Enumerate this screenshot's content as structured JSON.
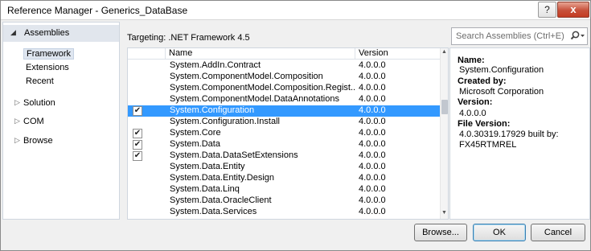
{
  "window": {
    "title": "Reference Manager - Generics_DataBase",
    "help": "?",
    "close": "x"
  },
  "nav": {
    "header": "Assemblies",
    "subitems": [
      "Framework",
      "Extensions",
      "Recent"
    ],
    "categories": [
      "Solution",
      "COM",
      "Browse"
    ]
  },
  "targeting": "Targeting: .NET Framework 4.5",
  "search": {
    "placeholder": "Search Assemblies (Ctrl+E)"
  },
  "grid": {
    "columns": {
      "name": "Name",
      "version": "Version"
    },
    "rows": [
      {
        "name": "System.AddIn.Contract",
        "version": "4.0.0.0",
        "checked": false,
        "selected": false
      },
      {
        "name": "System.ComponentModel.Composition",
        "version": "4.0.0.0",
        "checked": false,
        "selected": false
      },
      {
        "name": "System.ComponentModel.Composition.Regist...",
        "version": "4.0.0.0",
        "checked": false,
        "selected": false
      },
      {
        "name": "System.ComponentModel.DataAnnotations",
        "version": "4.0.0.0",
        "checked": false,
        "selected": false
      },
      {
        "name": "System.Configuration",
        "version": "4.0.0.0",
        "checked": true,
        "selected": true
      },
      {
        "name": "System.Configuration.Install",
        "version": "4.0.0.0",
        "checked": false,
        "selected": false
      },
      {
        "name": "System.Core",
        "version": "4.0.0.0",
        "checked": true,
        "selected": false
      },
      {
        "name": "System.Data",
        "version": "4.0.0.0",
        "checked": true,
        "selected": false
      },
      {
        "name": "System.Data.DataSetExtensions",
        "version": "4.0.0.0",
        "checked": true,
        "selected": false
      },
      {
        "name": "System.Data.Entity",
        "version": "4.0.0.0",
        "checked": false,
        "selected": false
      },
      {
        "name": "System.Data.Entity.Design",
        "version": "4.0.0.0",
        "checked": false,
        "selected": false
      },
      {
        "name": "System.Data.Linq",
        "version": "4.0.0.0",
        "checked": false,
        "selected": false
      },
      {
        "name": "System.Data.OracleClient",
        "version": "4.0.0.0",
        "checked": false,
        "selected": false
      },
      {
        "name": "System.Data.Services",
        "version": "4.0.0.0",
        "checked": false,
        "selected": false
      }
    ]
  },
  "details": {
    "name_label": "Name:",
    "name_value": "System.Configuration",
    "created_label": "Created by:",
    "created_value": "Microsoft Corporation",
    "version_label": "Version:",
    "version_value": "4.0.0.0",
    "file_label": "File Version:",
    "file_value1": "4.0.30319.17929 built by:",
    "file_value2": "FX45RTMREL"
  },
  "buttons": {
    "browse": "Browse...",
    "ok": "OK",
    "cancel": "Cancel"
  },
  "colors": {
    "selection": "#3399ff",
    "nav_header": "#e1e6ed"
  }
}
